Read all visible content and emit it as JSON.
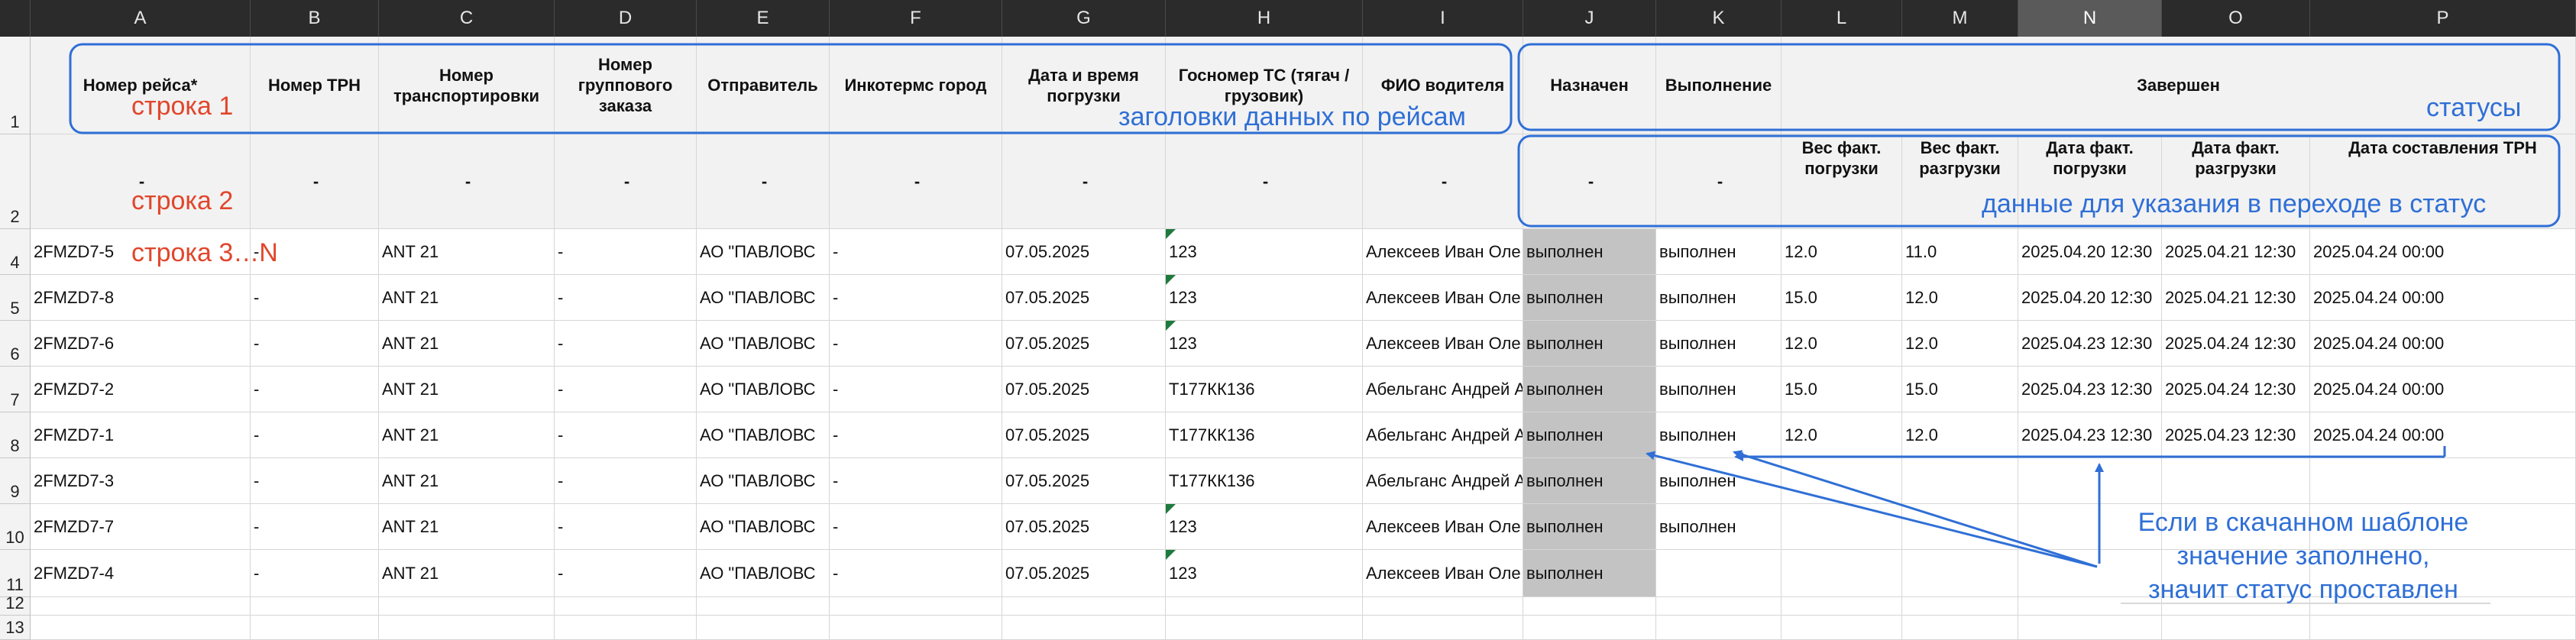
{
  "columns": [
    "A",
    "B",
    "C",
    "D",
    "E",
    "F",
    "G",
    "H",
    "I",
    "J",
    "K",
    "L",
    "M",
    "N",
    "O",
    "P"
  ],
  "selected_column": "N",
  "row_numbers": [
    "1",
    "2",
    "4",
    "5",
    "6",
    "7",
    "8",
    "9",
    "10",
    "11",
    "12",
    "13"
  ],
  "header_row1": {
    "A": "Номер рейса*",
    "B": "Номер ТРН",
    "C": "Номер транспортировки",
    "D": "Номер группового заказа",
    "E": "Отправитель",
    "F": "Инкотермс город",
    "G": "Дата и время погрузки",
    "H": "Госномер ТС (тягач / грузовик)",
    "I": "ФИО водителя",
    "J": "Назначен",
    "K": "Выполнение",
    "LP": "Завершен"
  },
  "header_row2": {
    "dash": "-",
    "L": "Вес факт. погрузки",
    "M": "Вес факт. разгрузки",
    "N": "Дата факт. погрузки",
    "O": "Дата факт. разгрузки",
    "P": "Дата составления ТРН"
  },
  "rows": [
    {
      "A": "2FMZD7-5",
      "B": "-",
      "C": "ANT 21",
      "D": "-",
      "E": "АО \"ПАВЛОВС",
      "F": "-",
      "G": "07.05.2025",
      "H": "123",
      "I": "Алексеев Иван Оле",
      "J": "выполнен",
      "K": "выполнен",
      "L": "12.0",
      "M": "11.0",
      "N": "2025.04.20 12:30",
      "O": "2025.04.21 12:30",
      "P": "2025.04.24 00:00"
    },
    {
      "A": "2FMZD7-8",
      "B": "-",
      "C": "ANT 21",
      "D": "-",
      "E": "АО \"ПАВЛОВС",
      "F": "-",
      "G": "07.05.2025",
      "H": "123",
      "I": "Алексеев Иван Оле",
      "J": "выполнен",
      "K": "выполнен",
      "L": "15.0",
      "M": "12.0",
      "N": "2025.04.20 12:30",
      "O": "2025.04.21 12:30",
      "P": "2025.04.24 00:00"
    },
    {
      "A": "2FMZD7-6",
      "B": "-",
      "C": "ANT 21",
      "D": "-",
      "E": "АО \"ПАВЛОВС",
      "F": "-",
      "G": "07.05.2025",
      "H": "123",
      "I": "Алексеев Иван Оле",
      "J": "выполнен",
      "K": "выполнен",
      "L": "12.0",
      "M": "12.0",
      "N": "2025.04.23 12:30",
      "O": "2025.04.24 12:30",
      "P": "2025.04.24 00:00"
    },
    {
      "A": "2FMZD7-2",
      "B": "-",
      "C": "ANT 21",
      "D": "-",
      "E": "АО \"ПАВЛОВС",
      "F": "-",
      "G": "07.05.2025",
      "H": "Т177КК136",
      "I": "Абельганс Андрей А",
      "J": "выполнен",
      "K": "выполнен",
      "L": "15.0",
      "M": "15.0",
      "N": "2025.04.23 12:30",
      "O": "2025.04.24 12:30",
      "P": "2025.04.24 00:00"
    },
    {
      "A": "2FMZD7-1",
      "B": "-",
      "C": "ANT 21",
      "D": "-",
      "E": "АО \"ПАВЛОВС",
      "F": "-",
      "G": "07.05.2025",
      "H": "Т177КК136",
      "I": "Абельганс Андрей А",
      "J": "выполнен",
      "K": "выполнен",
      "L": "12.0",
      "M": "12.0",
      "N": "2025.04.23 12:30",
      "O": "2025.04.23 12:30",
      "P": "2025.04.24 00:00"
    },
    {
      "A": "2FMZD7-3",
      "B": "-",
      "C": "ANT 21",
      "D": "-",
      "E": "АО \"ПАВЛОВС",
      "F": "-",
      "G": "07.05.2025",
      "H": "Т177КК136",
      "I": "Абельганс Андрей А",
      "J": "выполнен",
      "K": "выполнен",
      "L": "",
      "M": "",
      "N": "",
      "O": "",
      "P": ""
    },
    {
      "A": "2FMZD7-7",
      "B": "-",
      "C": "ANT 21",
      "D": "-",
      "E": "АО \"ПАВЛОВС",
      "F": "-",
      "G": "07.05.2025",
      "H": "123",
      "I": "Алексеев Иван Оле",
      "J": "выполнен",
      "K": "выполнен",
      "L": "",
      "M": "",
      "N": "",
      "O": "",
      "P": ""
    },
    {
      "A": "2FMZD7-4",
      "B": "-",
      "C": "ANT 21",
      "D": "-",
      "E": "АО \"ПАВЛОВС",
      "F": "-",
      "G": "07.05.2025",
      "H": "123",
      "I": "Алексеев Иван Оле",
      "J": "выполнен",
      "K": "",
      "L": "",
      "M": "",
      "N": "",
      "O": "",
      "P": ""
    }
  ],
  "annotations": {
    "row1_label": "строка 1",
    "row2_label": "строка 2",
    "row3_label": "строка 3…N",
    "headers_caption": "заголовки данных по рейсам",
    "statuses_caption": "статусы",
    "status_data_caption": "данные для указания в переходе в статус",
    "note_lines": [
      "Если в скачанном шаблоне",
      "значение заполнено,",
      "значит статус проставлен"
    ]
  },
  "colors": {
    "annotation_blue": "#2f6fd6",
    "annotation_red": "#e1462b",
    "header_dark": "#2b2b2b",
    "assigned_column_gray": "#c3c3c3",
    "comment_marker_green": "#1f7a3d"
  }
}
